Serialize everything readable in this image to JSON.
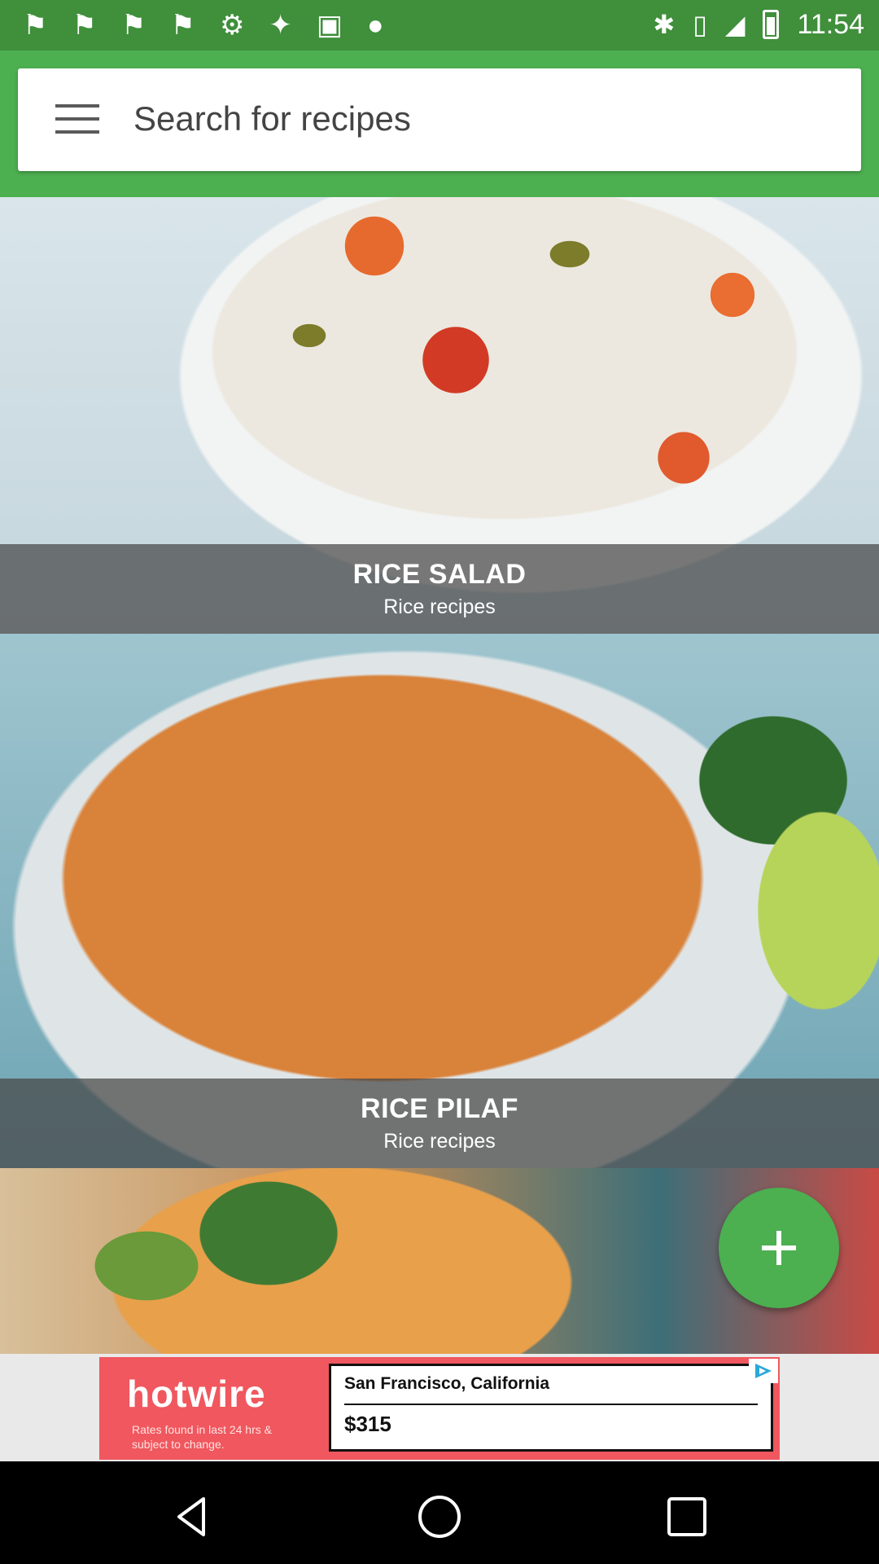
{
  "status_bar": {
    "time": "11:54",
    "left_icons": [
      "notification-icon",
      "notification-icon",
      "notification-icon",
      "notification-icon",
      "settings-icon",
      "satellite-icon",
      "lock-icon",
      "android-icon"
    ],
    "right_icons": [
      "bluetooth-icon",
      "vibrate-icon",
      "signal-icon",
      "battery-icon"
    ]
  },
  "app_bar": {
    "search_placeholder": "Search for recipes",
    "menu_icon": "menu-icon",
    "color": "#4caf50"
  },
  "recipes": [
    {
      "title": "RICE SALAD",
      "category": "Rice recipes"
    },
    {
      "title": "RICE PILAF",
      "category": "Rice recipes"
    }
  ],
  "fab": {
    "icon": "plus-icon"
  },
  "ad": {
    "brand": "hotwire",
    "fine_print": "Rates found in last 24 hrs & subject to change.",
    "location": "San Francisco, California",
    "price": "$315",
    "adchoices_icon": "adchoices-icon"
  },
  "nav_bar": {
    "buttons": [
      "back-icon",
      "home-icon",
      "recents-icon"
    ]
  }
}
